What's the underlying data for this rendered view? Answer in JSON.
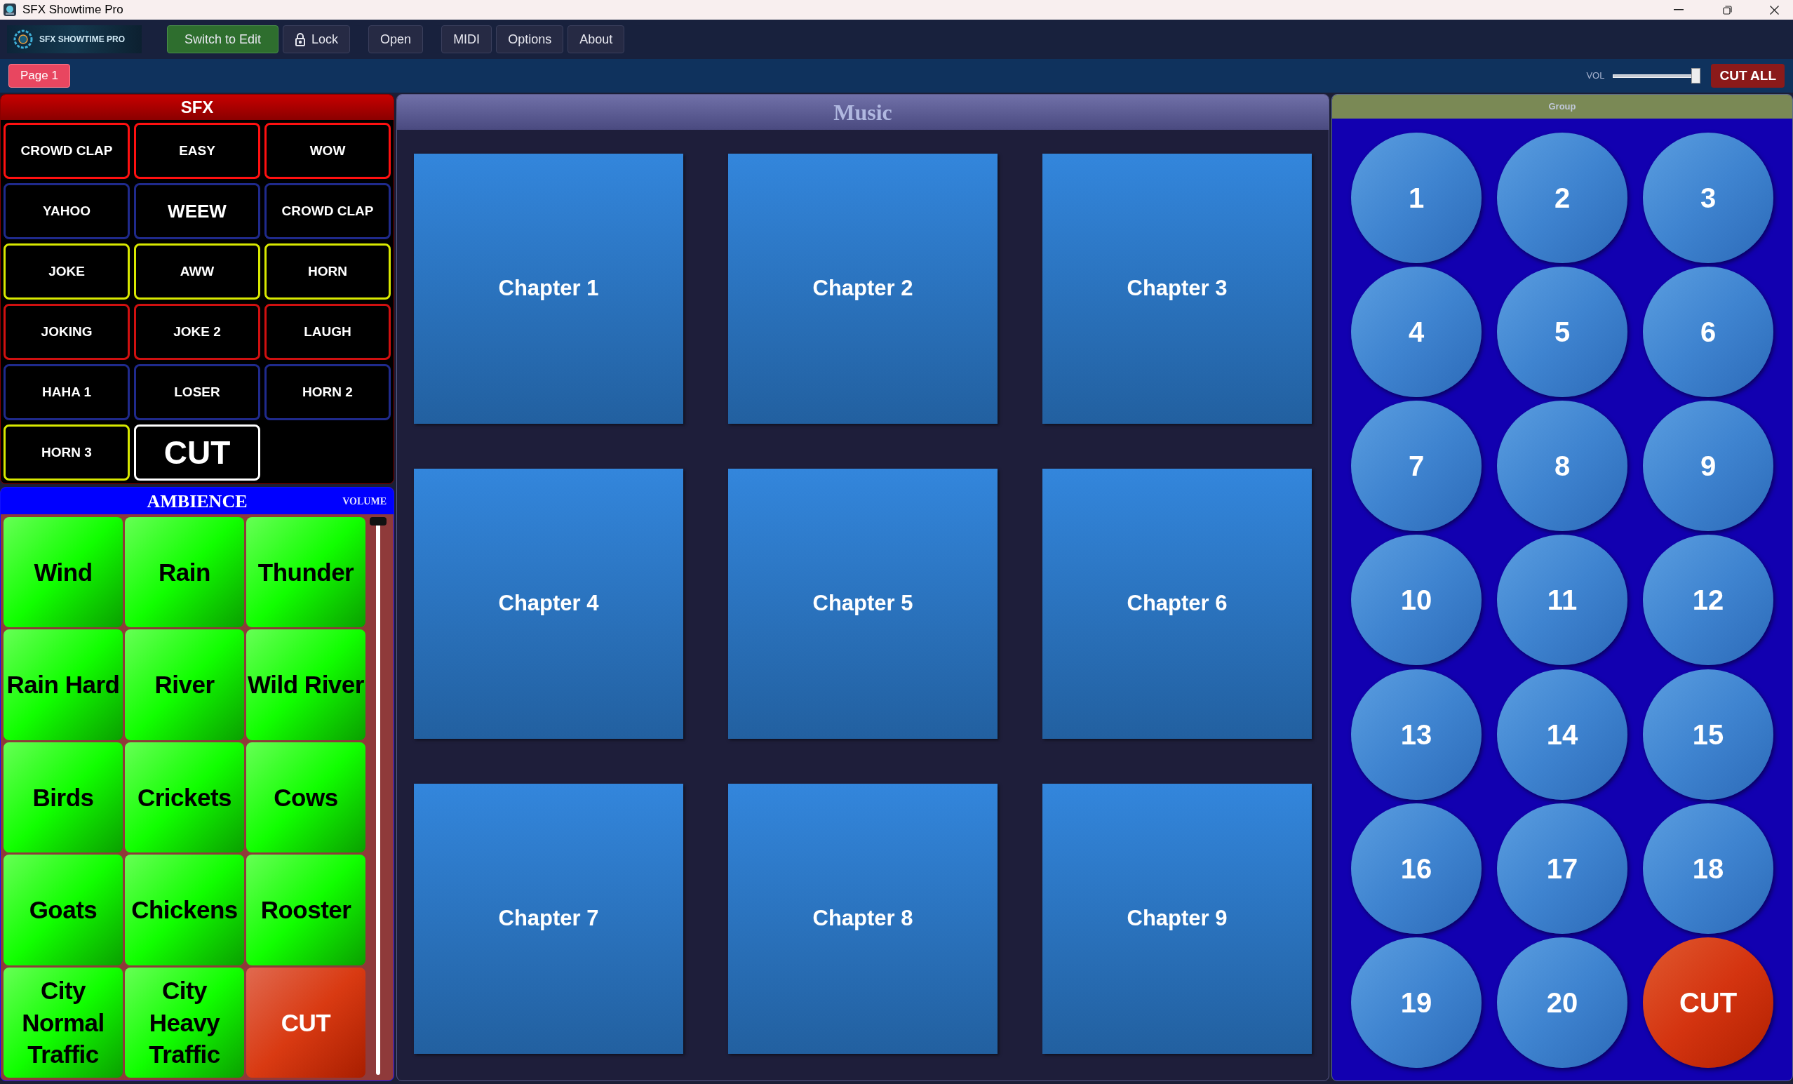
{
  "window": {
    "title": "SFX Showtime Pro"
  },
  "toolbar": {
    "logo": "SFX SHOWTIME PRO",
    "buttons": [
      {
        "label": "Switch to Edit",
        "kind": "primary"
      },
      {
        "label": "Lock",
        "kind": "lock"
      },
      {
        "label": "Open",
        "kind": "plain"
      },
      {
        "label": "MIDI",
        "kind": "plain"
      },
      {
        "label": "Options",
        "kind": "plain"
      },
      {
        "label": "About",
        "kind": "plain"
      }
    ]
  },
  "pages": [
    {
      "label": "Page 1",
      "selected": true
    }
  ],
  "master": {
    "label": "VOL",
    "level": 0.95,
    "cut_all": "CUT ALL"
  },
  "sfx": {
    "title": "SFX",
    "buttons": [
      {
        "label": "CROWD CLAP",
        "color": "#ff1010"
      },
      {
        "label": "EASY",
        "color": "#ff1010"
      },
      {
        "label": "WOW",
        "color": "#ff1010"
      },
      {
        "label": "YAHOO",
        "color": "#1f2a8c"
      },
      {
        "label": "WEEW",
        "color": "#1f2a8c",
        "kind": "large"
      },
      {
        "label": "CROWD CLAP",
        "color": "#1f2a8c"
      },
      {
        "label": "JOKE",
        "color": "#d8e800"
      },
      {
        "label": "AWW",
        "color": "#d8e800"
      },
      {
        "label": "HORN",
        "color": "#d8e800"
      },
      {
        "label": "JOKING",
        "color": "#d01010"
      },
      {
        "label": "JOKE 2",
        "color": "#d01010"
      },
      {
        "label": "LAUGH",
        "color": "#d01010"
      },
      {
        "label": "HAHA 1",
        "color": "#1f2a8c"
      },
      {
        "label": "LOSER",
        "color": "#1f2a8c"
      },
      {
        "label": "HORN 2",
        "color": "#1f2a8c"
      },
      {
        "label": "HORN 3",
        "color": "#d8e800"
      },
      {
        "label": "CUT",
        "color": "#ffffff",
        "kind": "cut"
      }
    ]
  },
  "ambience": {
    "title": "AMBIENCE",
    "volume_label": "VOLUME",
    "volume": {
      "level": 1
    },
    "pads": [
      {
        "label": "Wind",
        "kind": "pad"
      },
      {
        "label": "Rain",
        "kind": "pad"
      },
      {
        "label": "Thunder",
        "kind": "pad"
      },
      {
        "label": "Rain Hard",
        "kind": "pad"
      },
      {
        "label": "River",
        "kind": "pad"
      },
      {
        "label": "Wild River",
        "kind": "pad"
      },
      {
        "label": "Birds",
        "kind": "pad"
      },
      {
        "label": "Crickets",
        "kind": "pad"
      },
      {
        "label": "Cows",
        "kind": "pad"
      },
      {
        "label": "Goats",
        "kind": "pad"
      },
      {
        "label": "Chickens",
        "kind": "pad"
      },
      {
        "label": "Rooster",
        "kind": "pad"
      },
      {
        "label": "City Normal Traffic",
        "kind": "pad"
      },
      {
        "label": "City Heavy Traffic",
        "kind": "pad"
      },
      {
        "label": "CUT",
        "kind": "cut"
      }
    ]
  },
  "music": {
    "title": "Music",
    "tracks": [
      "Chapter 1",
      "Chapter 2",
      "Chapter 3",
      "Chapter 4",
      "Chapter 5",
      "Chapter 6",
      "Chapter 7",
      "Chapter 8",
      "Chapter 9"
    ]
  },
  "group": {
    "title": "Group",
    "buttons": [
      {
        "label": "1",
        "kind": "number"
      },
      {
        "label": "2",
        "kind": "number"
      },
      {
        "label": "3",
        "kind": "number"
      },
      {
        "label": "4",
        "kind": "number"
      },
      {
        "label": "5",
        "kind": "number"
      },
      {
        "label": "6",
        "kind": "number"
      },
      {
        "label": "7",
        "kind": "number"
      },
      {
        "label": "8",
        "kind": "number"
      },
      {
        "label": "9",
        "kind": "number"
      },
      {
        "label": "10",
        "kind": "number"
      },
      {
        "label": "11",
        "kind": "number"
      },
      {
        "label": "12",
        "kind": "number"
      },
      {
        "label": "13",
        "kind": "number"
      },
      {
        "label": "14",
        "kind": "number"
      },
      {
        "label": "15",
        "kind": "number"
      },
      {
        "label": "16",
        "kind": "number"
      },
      {
        "label": "17",
        "kind": "number"
      },
      {
        "label": "18",
        "kind": "number"
      },
      {
        "label": "19",
        "kind": "number"
      },
      {
        "label": "20",
        "kind": "number"
      },
      {
        "label": "CUT",
        "kind": "cut"
      }
    ]
  }
}
